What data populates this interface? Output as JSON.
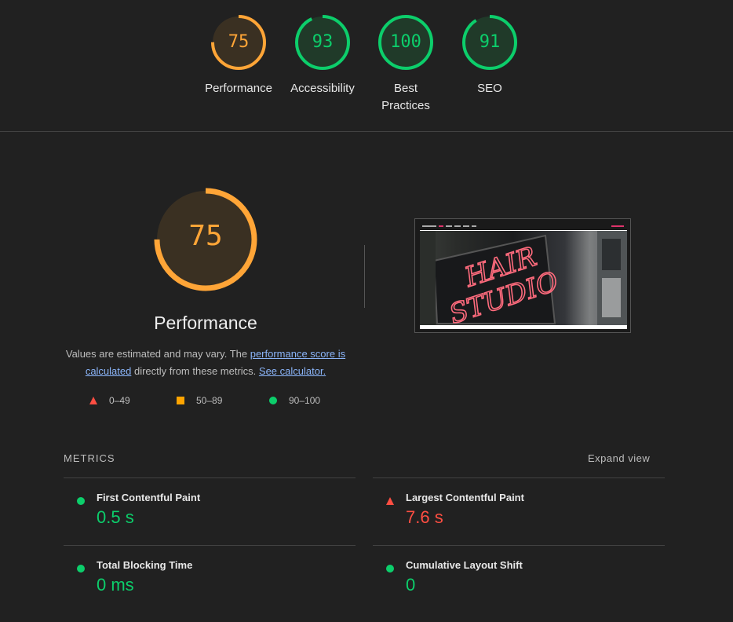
{
  "gauges": [
    {
      "score": "75",
      "label": "Performance",
      "value": 0.75,
      "color": "#ffa537",
      "fill": "#3a3022"
    },
    {
      "score": "93",
      "label": "Accessibility",
      "value": 0.93,
      "color": "#0cce6b",
      "fill": "#203a29"
    },
    {
      "score": "100",
      "label": "Best Practices",
      "value": 1.0,
      "color": "#0cce6b",
      "fill": "#203a29"
    },
    {
      "score": "91",
      "label": "SEO",
      "value": 0.91,
      "color": "#0cce6b",
      "fill": "#203a29"
    }
  ],
  "main": {
    "score": "75",
    "value": 0.75,
    "title": "Performance",
    "desc_prefix": "Values are estimated and may vary. The ",
    "desc_link1": "performance score is calculated",
    "desc_middle": " directly from these metrics. ",
    "desc_link2": "See calculator."
  },
  "legend": [
    {
      "range": "0–49",
      "shape": "triangle",
      "color": "#ff4e42"
    },
    {
      "range": "50–89",
      "shape": "square",
      "color": "#ffa400"
    },
    {
      "range": "90–100",
      "shape": "circle",
      "color": "#0cce6b"
    }
  ],
  "metrics": {
    "heading": "METRICS",
    "expand_label": "Expand view",
    "items": [
      {
        "title": "First Contentful Paint",
        "value": "0.5 s",
        "status": "pass",
        "color": "#0cce6b",
        "icon": "green-circle-icon"
      },
      {
        "title": "Largest Contentful Paint",
        "value": "7.6 s",
        "status": "fail",
        "color": "#ff4e42",
        "icon": "red-triangle-icon"
      },
      {
        "title": "Total Blocking Time",
        "value": "0 ms",
        "status": "pass",
        "color": "#0cce6b",
        "icon": "green-circle-icon"
      },
      {
        "title": "Cumulative Layout Shift",
        "value": "0",
        "status": "pass",
        "color": "#0cce6b",
        "icon": "green-circle-icon"
      }
    ]
  },
  "screenshot": {
    "sign_text": "HAIR STUDIO"
  }
}
